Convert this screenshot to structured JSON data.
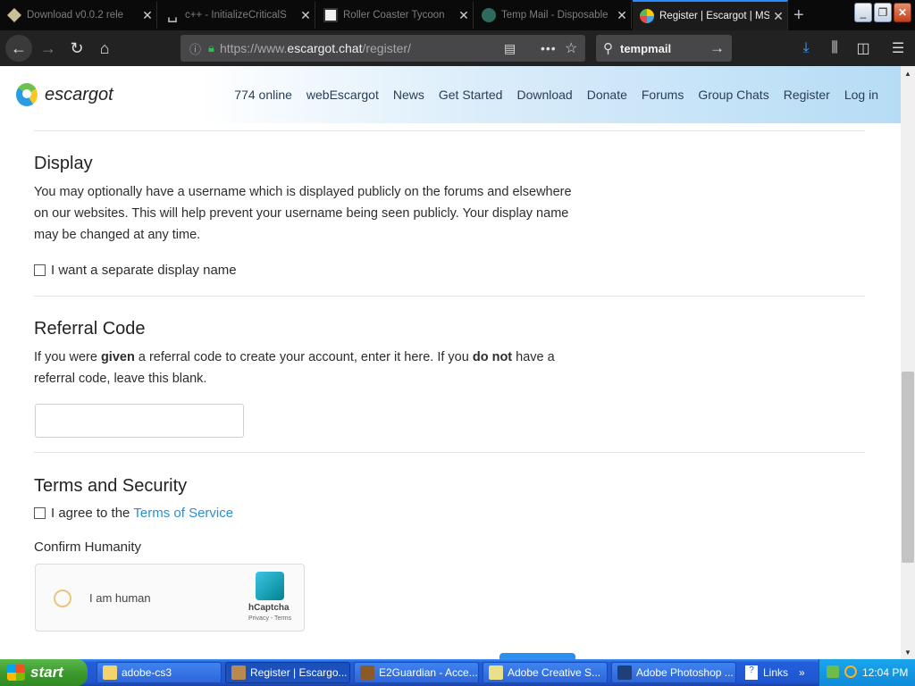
{
  "browser": {
    "tabs": [
      {
        "label": "Download v0.0.2 rele",
        "favicon": "flask-icon",
        "active": false
      },
      {
        "label": "c++ - InitializeCriticalS",
        "favicon": "stackoverflow-icon",
        "active": false
      },
      {
        "label": "Roller Coaster Tycoon",
        "favicon": "museum-icon",
        "active": false
      },
      {
        "label": "Temp Mail - Disposable",
        "favicon": "tempmail-icon",
        "active": false
      },
      {
        "label": "Register | Escargot | MS",
        "favicon": "escargot-icon",
        "active": true
      }
    ],
    "url_prefix": "https://www.",
    "url_domain": "escargot.chat",
    "url_path": "/register/",
    "search_value": "tempmail"
  },
  "site": {
    "logo_text": "escargot",
    "nav": [
      "774 online",
      "webEscargot",
      "News",
      "Get Started",
      "Download",
      "Donate",
      "Forums",
      "Group Chats",
      "Register",
      "Log in"
    ]
  },
  "display": {
    "heading": "Display",
    "paragraph": "You may optionally have a username which is displayed publicly on the forums and elsewhere on our websites. This will help prevent your username being seen publicly. Your display name may be changed at any time.",
    "checkbox_label": "I want a separate display name"
  },
  "referral": {
    "heading": "Referral Code",
    "text_1": "If you were ",
    "text_bold_1": "given",
    "text_2": " a referral code to create your account, enter it here. If you ",
    "text_bold_2": "do not",
    "text_3": " have a referral code, leave this blank.",
    "input_value": ""
  },
  "terms": {
    "heading": "Terms and Security",
    "agree_label": "I agree to the",
    "tos_link": "Terms of Service",
    "confirm_label": "Confirm Humanity",
    "captcha_label": "I am human",
    "captcha_brand": "hCaptcha",
    "captcha_links": "Privacy - Terms"
  },
  "taskbar": {
    "start_label": "start",
    "tasks": [
      {
        "label": "adobe-cs3",
        "active": false
      },
      {
        "label": "Register | Escargo...",
        "active": true
      },
      {
        "label": "E2Guardian - Acce...",
        "active": false
      },
      {
        "label": "Adobe Creative S...",
        "active": false
      },
      {
        "label": "Adobe Photoshop ...",
        "active": false
      }
    ],
    "links_label": "Links",
    "clock": "12:04 PM"
  }
}
